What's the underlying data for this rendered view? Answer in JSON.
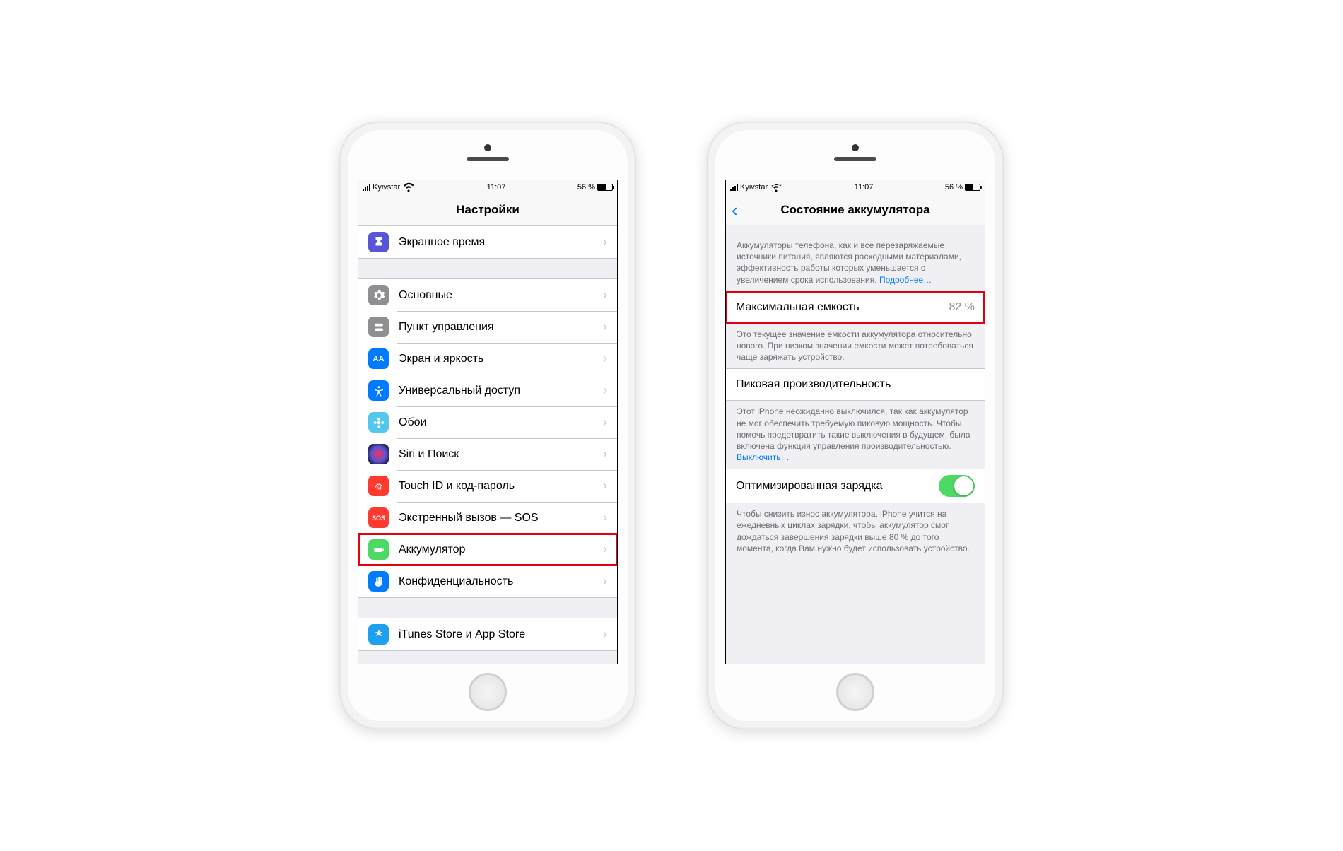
{
  "status": {
    "carrier": "Kyivstar",
    "time": "11:07",
    "battery_text": "56 %"
  },
  "left": {
    "title": "Настройки",
    "items": {
      "screen_time": {
        "label": "Экранное время"
      },
      "general": {
        "label": "Основные"
      },
      "control": {
        "label": "Пункт управления"
      },
      "display": {
        "label": "Экран и яркость"
      },
      "accessibility": {
        "label": "Универсальный доступ"
      },
      "wallpaper": {
        "label": "Обои"
      },
      "siri": {
        "label": "Siri и Поиск"
      },
      "touchid": {
        "label": "Touch ID и код-пароль"
      },
      "sos": {
        "label": "Экстренный вызов — SOS"
      },
      "battery": {
        "label": "Аккумулятор"
      },
      "privacy": {
        "label": "Конфиденциальность"
      },
      "itunes": {
        "label": "iTunes Store и App Store"
      }
    }
  },
  "right": {
    "title": "Состояние аккумулятора",
    "intro": "Аккумуляторы телефона, как и все перезаряжаемые источники питания, являются расходными материалами, эффективность работы которых уменьшается с увеличением срока использования.",
    "learn_more": "Подробнее…",
    "max_capacity_label": "Максимальная емкость",
    "max_capacity_value": "82 %",
    "capacity_note": "Это текущее значение емкости аккумулятора относительно нового. При низком значении емкости может потребоваться чаще заряжать устройство.",
    "peak_label": "Пиковая производительность",
    "peak_note": "Этот iPhone неожиданно выключился, так как аккумулятор не мог обеспечить требуемую пиковую мощность. Чтобы помочь предотвратить такие выключения в будущем, была включена функция управления производительностью.",
    "peak_disable": "Выключить…",
    "optimized_label": "Оптимизированная зарядка",
    "optimized_note": "Чтобы снизить износ аккумулятора, iPhone учится на ежедневных циклах зарядки, чтобы аккумулятор смог дождаться завершения зарядки выше 80 % до того момента, когда Вам нужно будет использовать устройство."
  }
}
